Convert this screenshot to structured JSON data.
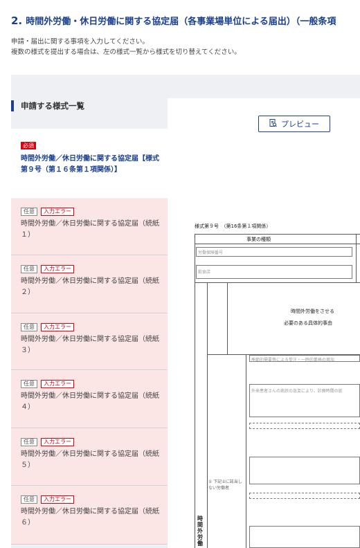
{
  "header": {
    "number": "2.",
    "title": "時間外労働・休日労働に関する協定届（各事業場単位による届出）（一般条項",
    "desc_line1": "申請・届出に関する事項を入力してください。",
    "desc_line2": "複数の様式を提出する場合は、左の様式一覧から様式を切り替えてください。"
  },
  "sidebar": {
    "title": "申請する様式一覧",
    "items": [
      {
        "tags": [
          "必須"
        ],
        "label": "時間外労働／休日労働に関する協定届【様式第９号（第１６条第１項関係）】",
        "state": "active"
      },
      {
        "tags": [
          "任意",
          "入力エラー"
        ],
        "label": "時間外労働／休日労働に関する協定届（続紙１）",
        "state": "error"
      },
      {
        "tags": [
          "任意",
          "入力エラー"
        ],
        "label": "時間外労働／休日労働に関する協定届（続紙２）",
        "state": "error"
      },
      {
        "tags": [
          "任意",
          "入力エラー"
        ],
        "label": "時間外労働／休日労働に関する協定届（続紙３）",
        "state": "error"
      },
      {
        "tags": [
          "任意",
          "入力エラー"
        ],
        "label": "時間外労働／休日労働に関する協定届（続紙４）",
        "state": "error"
      },
      {
        "tags": [
          "任意",
          "入力エラー"
        ],
        "label": "時間外労働／休日労働に関する協定届（続紙５）",
        "state": "error"
      },
      {
        "tags": [
          "任意",
          "入力エラー"
        ],
        "label": "時間外労働／休日労働に関する協定届（続紙６）",
        "state": "error"
      }
    ]
  },
  "preview": {
    "label": "プレビュー",
    "icon": "preview-icon"
  },
  "form": {
    "form_number": "様式第９号　（第16条第１項関係）",
    "col_business_type": "事業の種類",
    "ph_insurance": "労働保険番号",
    "ph_business": "飲食店",
    "reason_header_1": "時間外労働をさせる",
    "reason_header_2": "必要のある具体的事由",
    "ph_reason1": "季節的需要等による受注・一時的業務の増加",
    "ph_reason2": "外来患者さんの病状の急変により、診療時間の延",
    "worker_note": "① 下記②に該当しない労働者",
    "vertical_label": "時間外労働"
  },
  "colors": {
    "accent": "#1a3f8f",
    "error": "#d9000d",
    "error_bg": "#fbe5e5"
  }
}
